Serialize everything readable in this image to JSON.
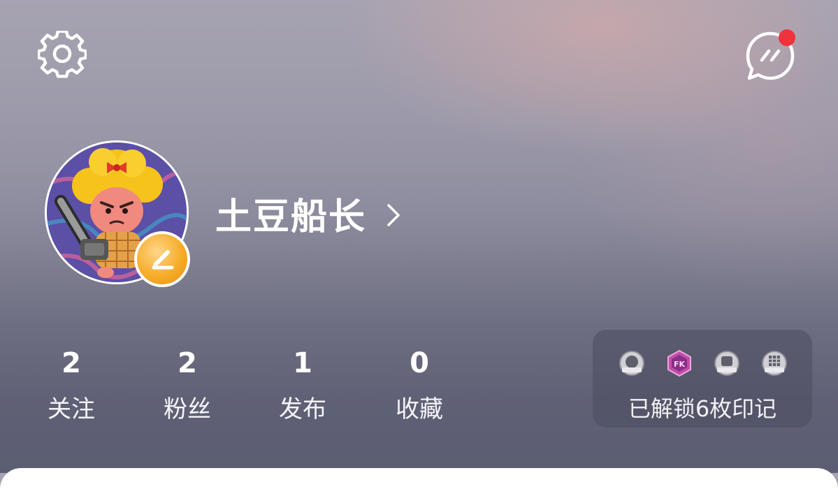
{
  "profile": {
    "username": "土豆船长"
  },
  "stats": [
    {
      "value": "2",
      "label": "关注"
    },
    {
      "value": "2",
      "label": "粉丝"
    },
    {
      "value": "1",
      "label": "发布"
    },
    {
      "value": "0",
      "label": "收藏"
    }
  ],
  "badges": {
    "summary": "已解锁6枚印记",
    "icons": [
      "silver-medal-icon",
      "pink-hexagon-medal-icon",
      "silver-medal-icon",
      "silver-medal-icon"
    ]
  },
  "header": {
    "settings_icon": "gear-icon",
    "messages_icon": "chat-bubble-icon",
    "notification_color": "#f0323c"
  },
  "colors": {
    "badge_gold": "#f6ad2a",
    "text": "#ffffff"
  }
}
